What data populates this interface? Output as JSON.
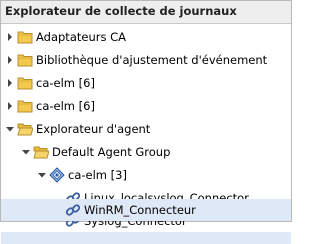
{
  "panel": {
    "title": "Explorateur de collecte de journaux"
  },
  "tree": {
    "nodes": [
      {
        "label": "Adaptateurs CA",
        "expanded": false,
        "icon": "folder-icon"
      },
      {
        "label": "Bibliothèque d'ajustement d'événement",
        "expanded": false,
        "icon": "folder-icon"
      },
      {
        "label": "ca-elm [6]",
        "expanded": false,
        "icon": "folder-icon"
      },
      {
        "label": "ca-elm [6]",
        "expanded": false,
        "icon": "folder-icon"
      },
      {
        "label": "Explorateur d'agent",
        "expanded": true,
        "icon": "folder-open-icon"
      },
      {
        "label": "Default Agent Group",
        "expanded": true,
        "icon": "folder-open-icon"
      },
      {
        "label": "ca-elm [3]",
        "expanded": true,
        "icon": "agent-icon"
      },
      {
        "label": "Linux_localsyslog_Connector",
        "icon": "connector-icon"
      },
      {
        "label": "Syslog_Connector",
        "icon": "connector-icon"
      },
      {
        "label": "WinRM_Connecteur",
        "icon": "connector-icon",
        "selected": true
      }
    ]
  },
  "colors": {
    "folder": "#f2c94c",
    "folder_stroke": "#b8902a",
    "connector": "#3a5f9e",
    "selection": "#dfe8f6",
    "header_bg": "#eeeeee"
  }
}
